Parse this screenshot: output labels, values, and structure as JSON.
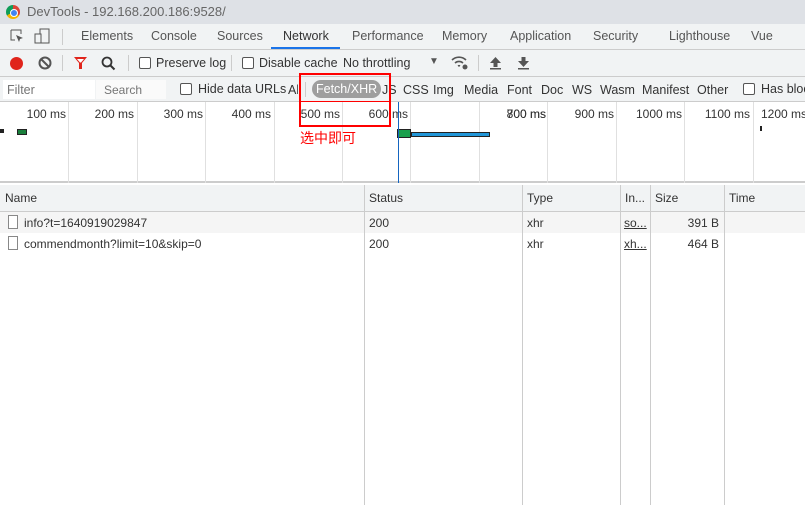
{
  "window": {
    "title": "DevTools - 192.168.200.186:9528/"
  },
  "tabs": [
    "Elements",
    "Console",
    "Sources",
    "Network",
    "Performance",
    "Memory",
    "Application",
    "Security",
    "Lighthouse",
    "Vue"
  ],
  "active_tab": "Network",
  "toolbar": {
    "preserve_log": "Preserve log",
    "disable_cache": "Disable cache",
    "throttling": "No throttling"
  },
  "filterbar": {
    "filter_placeholder": "Filter",
    "search_placeholder": "Search",
    "hide_data_urls": "Hide data URLs",
    "types": [
      "All",
      "Fetch/XHR",
      "JS",
      "CSS",
      "Img",
      "Media",
      "Font",
      "Doc",
      "WS",
      "Wasm",
      "Manifest",
      "Other"
    ],
    "selected_type": "Fetch/XHR",
    "has_blocked": "Has bloc"
  },
  "annotation": {
    "text": "选中即可",
    "color": "#ff0000"
  },
  "timeline": {
    "ticks": [
      "100 ms",
      "200 ms",
      "300 ms",
      "400 ms",
      "500 ms",
      "600 ms",
      "700 ms",
      "800 ms",
      "900 ms",
      "1000 ms",
      "1100 ms",
      "1200 ms"
    ]
  },
  "table": {
    "headers": [
      "Name",
      "Status",
      "Type",
      "In...",
      "Size",
      "Time"
    ],
    "rows": [
      {
        "name": "info?t=1640919029847",
        "status": "200",
        "type": "xhr",
        "initiator": "so...",
        "size": "391 B",
        "time": ""
      },
      {
        "name": "commendmonth?limit=10&skip=0",
        "status": "200",
        "type": "xhr",
        "initiator": "xh...",
        "size": "464 B",
        "time": ""
      }
    ]
  }
}
